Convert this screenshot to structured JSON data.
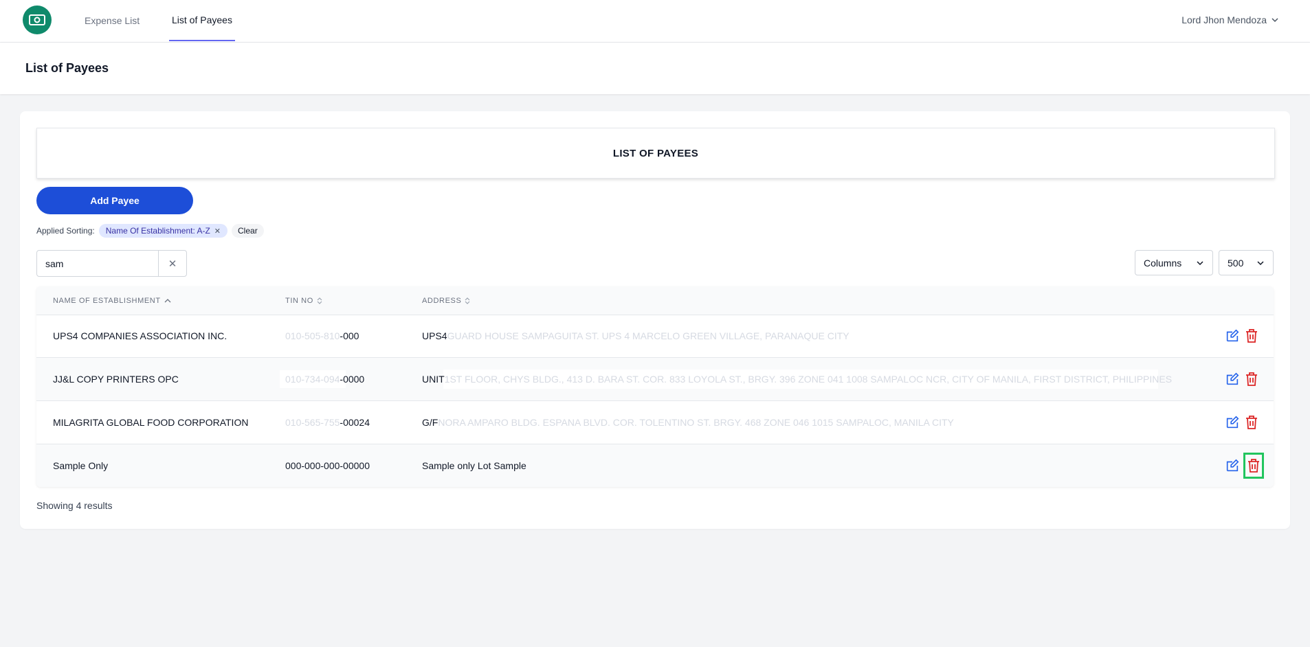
{
  "brand": {
    "logo_icon": "money-bill-icon",
    "color": "#0f8a6b"
  },
  "nav": {
    "items": [
      {
        "label": "Expense List",
        "active": false
      },
      {
        "label": "List of Payees",
        "active": true
      }
    ],
    "user": {
      "name": "Lord Jhon Mendoza",
      "icon": "chevron-down-icon"
    }
  },
  "page": {
    "title": "List of Payees"
  },
  "card": {
    "title": "LIST OF PAYEES",
    "add_button": "Add Payee",
    "sorting": {
      "label": "Applied Sorting:",
      "chip": "Name Of Establishment: A-Z",
      "clear": "Clear"
    },
    "search": {
      "value": "sam",
      "placeholder": ""
    },
    "columns_button": "Columns",
    "per_page": "500",
    "results_text": "Showing 4 results"
  },
  "table": {
    "headers": [
      {
        "label": "NAME OF ESTABLISHMENT",
        "sort": "asc"
      },
      {
        "label": "TIN NO",
        "sort": "none"
      },
      {
        "label": "ADDRESS",
        "sort": "none"
      }
    ],
    "rows": [
      {
        "name": "UPS4 COMPANIES ASSOCIATION INC.",
        "tin_masked": "010-505-810",
        "tin_visible": "-000",
        "addr_visible": "UPS4",
        "addr_masked": " GUARD HOUSE SAMPAGUITA ST. UPS 4 MARCELO GREEN VILLAGE, PARANAQUE CITY"
      },
      {
        "name": "JJ&L COPY PRINTERS OPC",
        "tin_masked": "010-734-094",
        "tin_visible": "-0000",
        "addr_visible": "UNIT",
        "addr_masked": " 1ST FLOOR, CHYS BLDG., 413 D. BARA ST. COR. 833 LOYOLA ST., BRGY. 396 ZONE 041 1008 SAMPALOC NCR, CITY OF MANILA, FIRST DISTRICT, PHILIPPINES"
      },
      {
        "name": "MILAGRITA GLOBAL FOOD CORPORATION",
        "tin_masked": "010-565-755",
        "tin_visible": "-00024",
        "addr_visible": "G/F",
        "addr_masked": " NORA AMPARO BLDG. ESPANA BLVD. COR. TOLENTINO ST. BRGY. 468 ZONE 046 1015 SAMPALOC, MANILA CITY"
      },
      {
        "name": "Sample Only",
        "tin_masked": "",
        "tin_visible": "000-000-000-00000",
        "addr_visible": "Sample only Lot Sample",
        "addr_masked": ""
      }
    ],
    "action_icons": {
      "edit": "edit-icon",
      "delete": "trash-icon"
    },
    "colors": {
      "edit": "#2563eb",
      "delete": "#dc2626",
      "highlight": "#22c55e"
    }
  }
}
